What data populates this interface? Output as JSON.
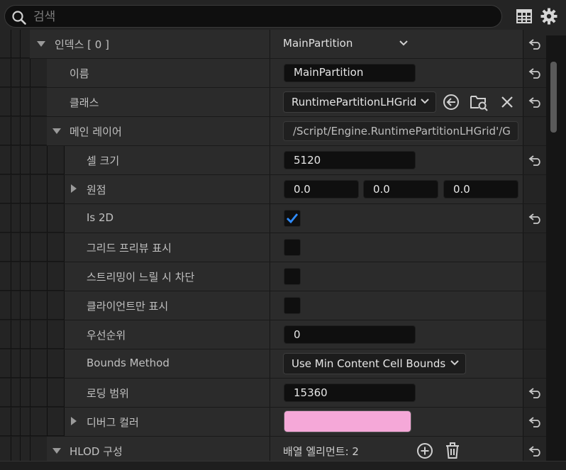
{
  "search": {
    "placeholder": "검색"
  },
  "toolbar": {
    "icons": [
      "table-view-icon",
      "settings-icon"
    ]
  },
  "rows": {
    "index": {
      "label": "인덱스 [ 0 ]",
      "value": "MainPartition"
    },
    "name": {
      "label": "이름",
      "value": "MainPartition"
    },
    "class": {
      "label": "클래스",
      "value": "RuntimePartitionLHGrid"
    },
    "main_layer": {
      "label": "메인 레이어",
      "value": "/Script/Engine.RuntimePartitionLHGrid'/G"
    },
    "cell_size": {
      "label": "셀 크기",
      "value": "5120"
    },
    "origin": {
      "label": "원점",
      "x": "0.0",
      "y": "0.0",
      "z": "0.0"
    },
    "is2d": {
      "label": "Is 2D",
      "checked": true
    },
    "grid_preview": {
      "label": "그리드 프리뷰 표시",
      "checked": false
    },
    "block_slow_streaming": {
      "label": "스트리밍이 느릴 시 차단",
      "checked": false
    },
    "client_only": {
      "label": "클라이언트만 표시",
      "checked": false
    },
    "priority": {
      "label": "우선순위",
      "value": "0"
    },
    "bounds_method": {
      "label": "Bounds Method",
      "value": "Use Min Content Cell Bounds"
    },
    "loading_range": {
      "label": "로딩 범위",
      "value": "15360"
    },
    "debug_color": {
      "label": "디버그 컬러",
      "color": "#f5a8d8"
    },
    "hlod": {
      "label": "HLOD 구성",
      "value": "배열 엘리먼트: 2"
    }
  },
  "colors": {
    "accent": "#2f8cff",
    "background": "#151515",
    "row": "#2b2b2b"
  }
}
